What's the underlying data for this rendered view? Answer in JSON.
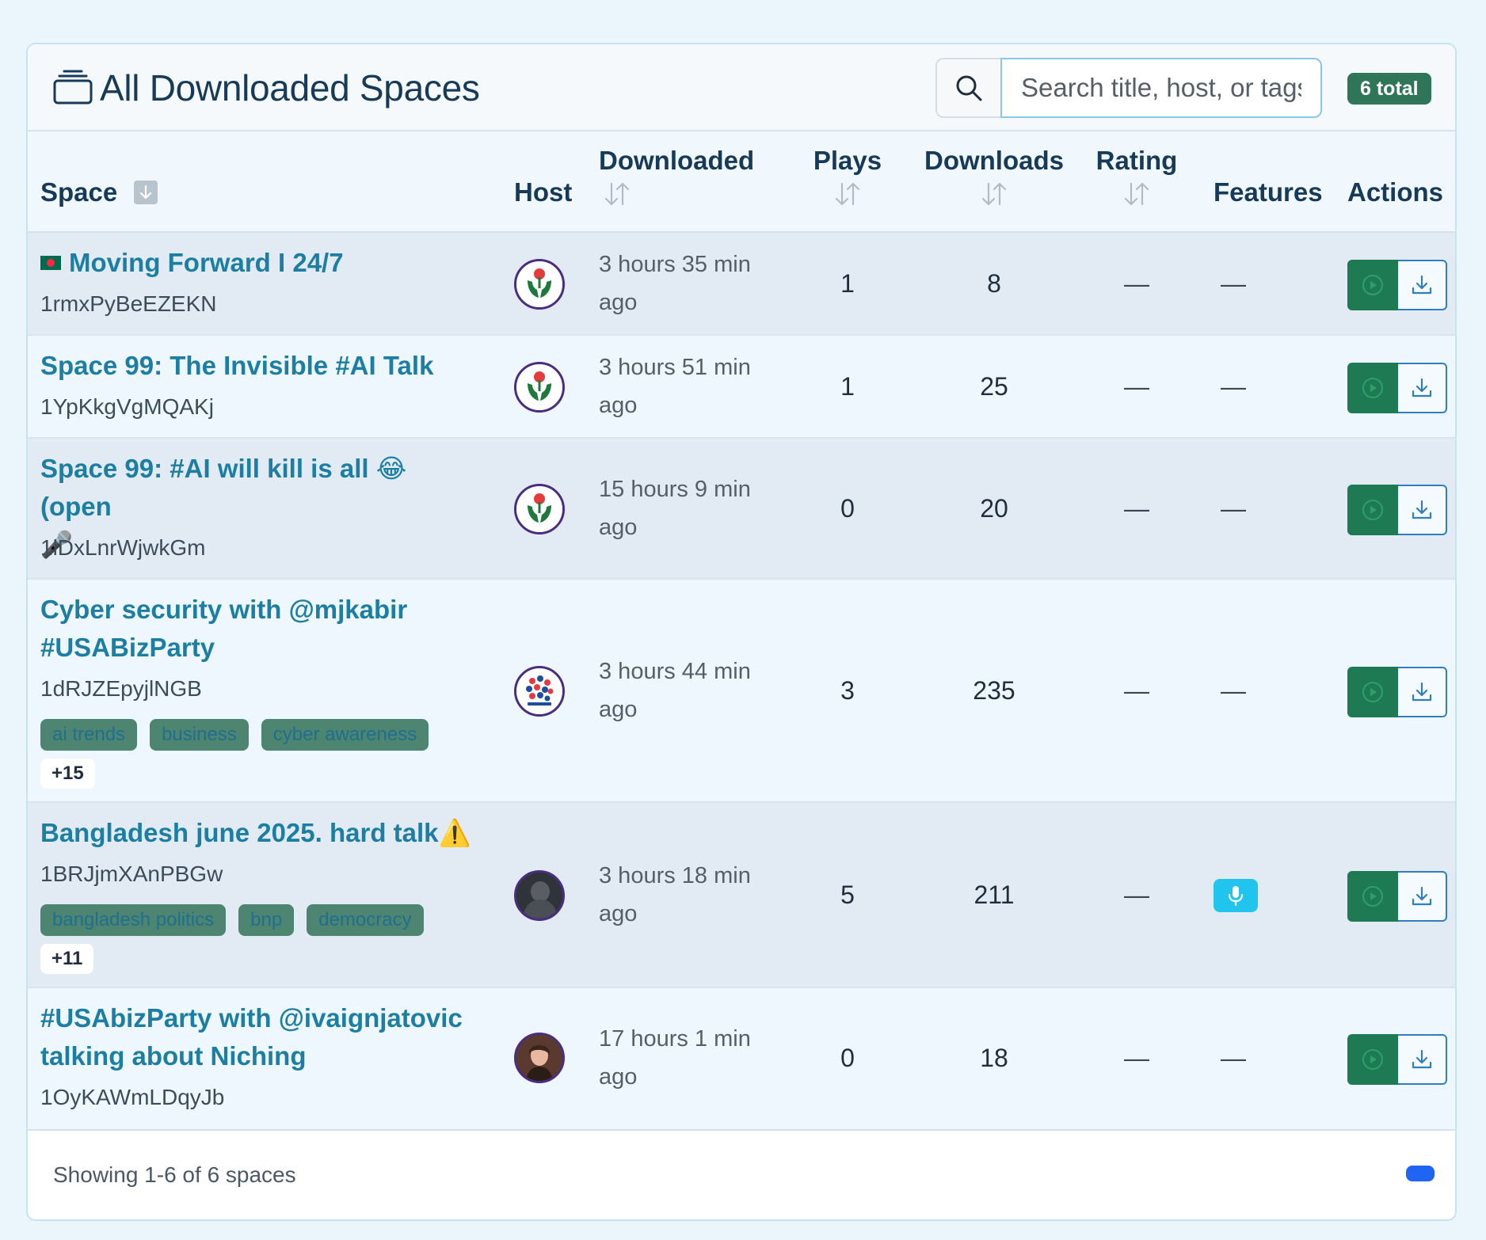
{
  "header": {
    "title": "All Downloaded Spaces",
    "search_placeholder": "Search title, host, or tags",
    "total_badge": "6 total"
  },
  "columns": {
    "space": "Space",
    "host": "Host",
    "downloaded": "Downloaded",
    "plays": "Plays",
    "downloads": "Downloads",
    "rating": "Rating",
    "features": "Features",
    "actions": "Actions"
  },
  "rows": [
    {
      "title": "Moving Forward I 24/7",
      "has_flag": true,
      "id": "1rmxPyBeEZEKN",
      "downloaded_line1": "3 hours 35 min",
      "downloaded_line2": "ago",
      "plays": "1",
      "downloads": "8",
      "rating": "—",
      "features": "—",
      "host_avatar": "green-hands-logo"
    },
    {
      "title": "Space 99: The Invisible #AI Talk",
      "id": "1YpKkgVgMQAKj",
      "downloaded_line1": "3 hours 51 min",
      "downloaded_line2": "ago",
      "plays": "1",
      "downloads": "25",
      "rating": "—",
      "features": "—",
      "host_avatar": "green-hands-logo"
    },
    {
      "title_line1": "Space 99: #AI will kill is all 😂 (open",
      "title_line2": "🎤",
      "id": "1lDxLnrWjwkGm",
      "downloaded_line1": "15 hours 9 min",
      "downloaded_line2": "ago",
      "plays": "0",
      "downloads": "20",
      "rating": "—",
      "features": "—",
      "host_avatar": "green-hands-logo"
    },
    {
      "title_line1": "Cyber security with @mjkabir",
      "title_line2": "#USABizParty",
      "id": "1dRJZEpyjlNGB",
      "tags": [
        "ai trends",
        "business",
        "cyber awareness"
      ],
      "more_tags": "+15",
      "downloaded_line1": "3 hours 44 min",
      "downloaded_line2": "ago",
      "plays": "3",
      "downloads": "235",
      "rating": "—",
      "features": "—",
      "host_avatar": "usabizparty-logo"
    },
    {
      "title": "Bangladesh june 2025. hard talk⚠️",
      "id": "1BRJjmXAnPBGw",
      "tags": [
        "bangladesh politics",
        "bnp",
        "democracy"
      ],
      "more_tags": "+11",
      "downloaded_line1": "3 hours 18 min",
      "downloaded_line2": "ago",
      "plays": "5",
      "downloads": "211",
      "rating": "—",
      "features_icon": "microphone-icon",
      "host_avatar": "dark-photo"
    },
    {
      "title_line1": "#USAbizParty with @ivaignjatovic",
      "title_line2": "talking about Niching",
      "id": "1OyKAWmLDqyJb",
      "downloaded_line1": "17 hours 1 min",
      "downloaded_line2": "ago",
      "plays": "0",
      "downloads": "18",
      "rating": "—",
      "features": "—",
      "host_avatar": "woman-portrait"
    }
  ],
  "footer": {
    "showing": "Showing 1-6 of 6 spaces"
  },
  "colors": {
    "title_link": "#1c7ea3",
    "badge": "#2f7558",
    "play_button": "#1e7a52",
    "download_border": "#2f7fc0",
    "mic_badge": "#21c4ec",
    "pager": "#1f64f2"
  }
}
